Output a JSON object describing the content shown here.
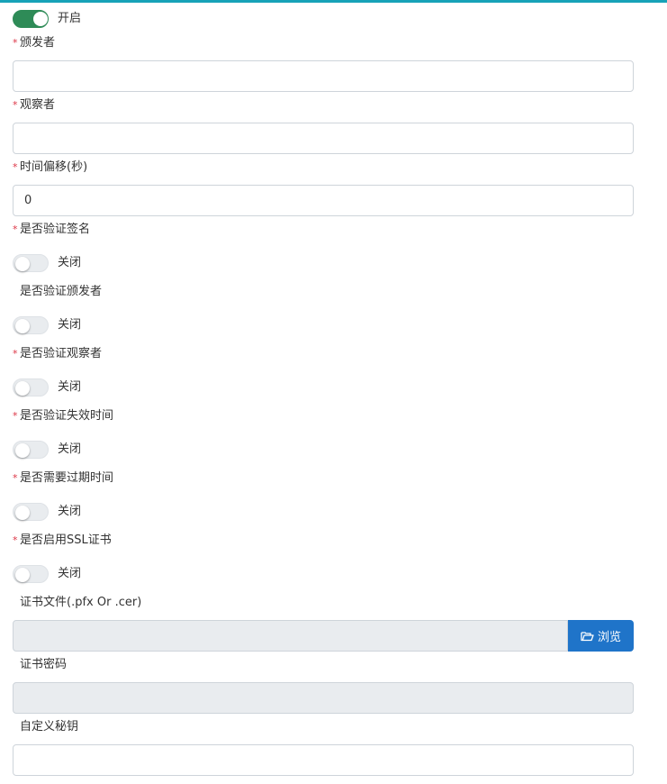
{
  "enabled": {
    "text": "开启",
    "on": true
  },
  "issuer": {
    "label": "颁发者",
    "required": true,
    "value": ""
  },
  "audience": {
    "label": "观察者",
    "required": true,
    "value": ""
  },
  "clock_skew": {
    "label": "时间偏移(秒)",
    "required": true,
    "value": "0"
  },
  "validate_signature": {
    "label": "是否验证签名",
    "required": true,
    "text": "关闭",
    "on": false
  },
  "validate_issuer": {
    "label": "是否验证颁发者",
    "required": false,
    "text": "关闭",
    "on": false
  },
  "validate_audience": {
    "label": "是否验证观察者",
    "required": true,
    "text": "关闭",
    "on": false
  },
  "validate_lifetime": {
    "label": "是否验证失效时间",
    "required": true,
    "text": "关闭",
    "on": false
  },
  "require_expiration": {
    "label": "是否需要过期时间",
    "required": true,
    "text": "关闭",
    "on": false
  },
  "use_ssl_cert": {
    "label": "是否启用SSL证书",
    "required": true,
    "text": "关闭",
    "on": false
  },
  "cert_file": {
    "label": "证书文件(.pfx Or .cer)",
    "required": false,
    "value": "",
    "browse_label": "浏览"
  },
  "cert_password": {
    "label": "证书密码",
    "required": false,
    "value": ""
  },
  "custom_secret": {
    "label": "自定义秘钥",
    "required": false,
    "value": ""
  },
  "colors": {
    "accent": "#17a2b8",
    "switch_on": "#2e8b57",
    "primary_button": "#1f74c9",
    "required": "#dc3545"
  },
  "icons": {
    "browse": "folder-open-icon"
  }
}
